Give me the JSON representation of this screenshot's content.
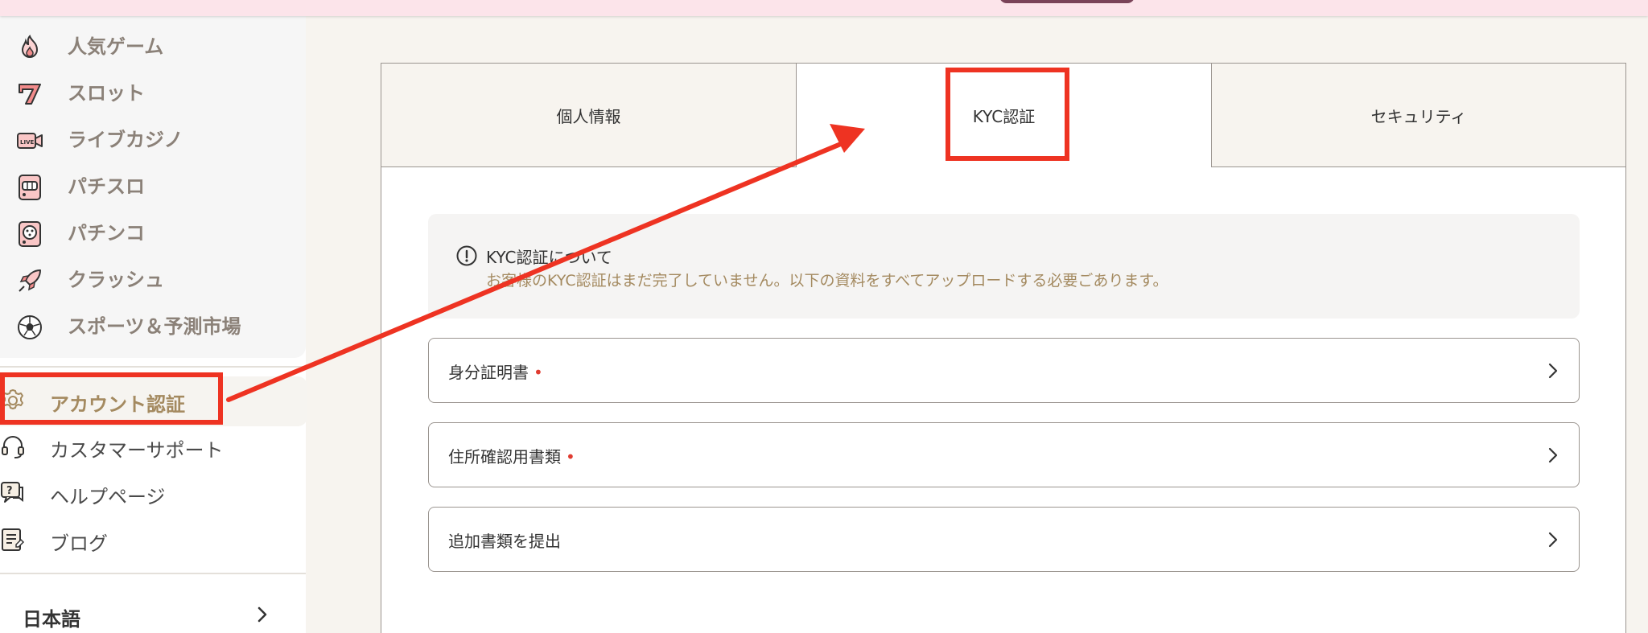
{
  "sidebar": {
    "games": [
      {
        "label": "人気ゲーム",
        "icon": "fire-icon"
      },
      {
        "label": "スロット",
        "icon": "lucky-seven-icon"
      },
      {
        "label": "ライブカジノ",
        "icon": "live-camera-icon"
      },
      {
        "label": "パチスロ",
        "icon": "pachislot-machine-icon"
      },
      {
        "label": "パチンコ",
        "icon": "pachinko-machine-icon"
      },
      {
        "label": "クラッシュ",
        "icon": "rocket-icon"
      },
      {
        "label": "スポーツ＆予測市場",
        "icon": "soccer-ball-icon"
      }
    ],
    "links": [
      {
        "label": "アカウント認証",
        "icon": "gear-icon",
        "active": true
      },
      {
        "label": "カスタマーサポート",
        "icon": "headset-icon"
      },
      {
        "label": "ヘルプページ",
        "icon": "help-chat-icon"
      },
      {
        "label": "ブログ",
        "icon": "blog-document-icon"
      }
    ],
    "language": "日本語"
  },
  "tabs": [
    {
      "label": "個人情報",
      "active": false
    },
    {
      "label": "KYC認証",
      "active": true
    },
    {
      "label": "セキュリティ",
      "active": false
    }
  ],
  "notice": {
    "title": "KYC認証について",
    "description": "お客様のKYC認証はまだ完了していません。以下の資料をすべてアップロードする必要ごあります。"
  },
  "documents": [
    {
      "label": "身分証明書",
      "required_mark": "•"
    },
    {
      "label": "住所確認用書類",
      "required_mark": "•"
    },
    {
      "label": "追加書類を提出",
      "required_mark": ""
    }
  ],
  "colors": {
    "accent": "#a48a60",
    "highlight": "#ee3322",
    "topbar": "#fce4ea",
    "required": "#e03c31"
  }
}
